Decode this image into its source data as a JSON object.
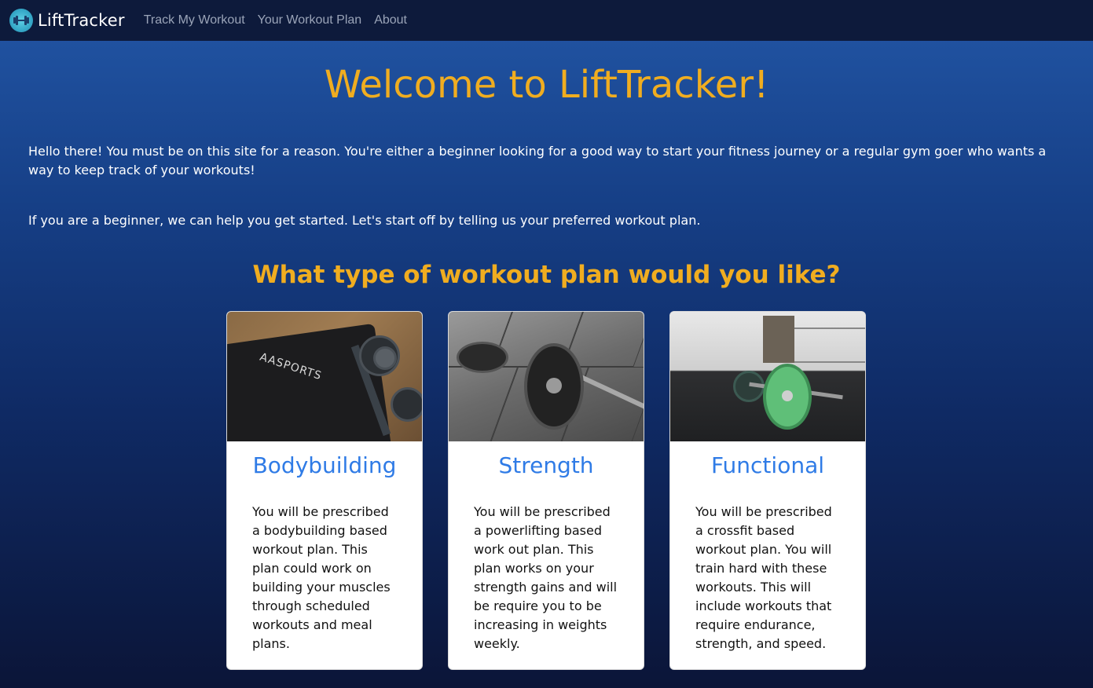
{
  "app": {
    "brand": "LiftTracker",
    "nav": [
      "Track My Workout",
      "Your Workout Plan",
      "About"
    ]
  },
  "main": {
    "title": "Welcome to LiftTracker!",
    "intro": [
      "Hello there! You must be on this site for a reason. You're either a beginner looking for a good way to start your fitness journey or a regular gym goer who wants a way to keep track of your workouts!",
      "If you are a beginner, we can help you get started. Let's start off by telling us your preferred workout plan."
    ],
    "question": "What type of workout plan would you like?",
    "cards": [
      {
        "title": "Bodybuilding",
        "text": "You will be prescribed a bodybuilding based workout plan. This plan could work on building your muscles through scheduled workouts and meal plans.",
        "image_text": "AASPORTS"
      },
      {
        "title": "Strength",
        "text": "You will be prescribed a powerlifting based work out plan. This plan works on your strength gains and will be require you to be increasing in weights weekly."
      },
      {
        "title": "Functional",
        "text": "You will be prescribed a crossfit based workout plan. You will train hard with these workouts. This will include workouts that require endurance, strength, and speed."
      }
    ]
  },
  "colors": {
    "accent": "#f0ad20",
    "card_title": "#2f7be6",
    "navbar": "#0d1a3b",
    "nav_link": "#9aa4b8"
  }
}
